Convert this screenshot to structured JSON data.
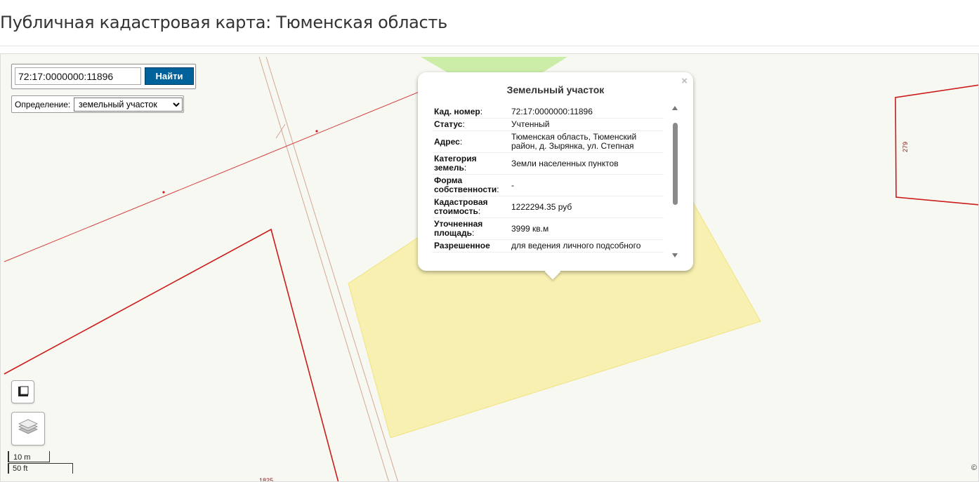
{
  "page": {
    "title": "Публичная кадастровая карта: Тюменская область"
  },
  "search": {
    "value": "72:17:0000000:11896",
    "button_label": "Найти"
  },
  "definition": {
    "label": "Определение:",
    "selected": "земельный участок",
    "options": [
      "земельный участок"
    ]
  },
  "popup": {
    "title": "Земельный участок",
    "close": "×",
    "rows": [
      {
        "key": "Кад. номер",
        "value": "72:17:0000000:11896"
      },
      {
        "key": "Статус",
        "value": "Учтенный"
      },
      {
        "key": "Адрес",
        "value": "Тюменская область, Тюменский район, д. Зырянка, ул. Степная"
      },
      {
        "key": "Категория земель",
        "value": "Земли населенных пунктов"
      },
      {
        "key": "Форма собственности",
        "value": "-"
      },
      {
        "key": "Кадастровая стоимость",
        "value": "1222294.35 руб"
      },
      {
        "key": "Уточненная площадь",
        "value": "3999 кв.м"
      },
      {
        "key": "Разрешенное",
        "value": "для ведения личного подсобного"
      }
    ]
  },
  "map": {
    "parcel_labels": {
      "right": "279",
      "bottom": "1825"
    },
    "colors": {
      "selected_fill": "#f7efa5",
      "green_fill": "#c6eba0",
      "boundary": "#cc1b1b",
      "road": "#d4a695",
      "background": "#f8f8f2",
      "button": "#00629a"
    }
  },
  "controls": {
    "measure": "ruler-icon",
    "layers": "layers-icon"
  },
  "scale": {
    "metric": "10 m",
    "imperial": "50 ft"
  },
  "attribution": "©"
}
